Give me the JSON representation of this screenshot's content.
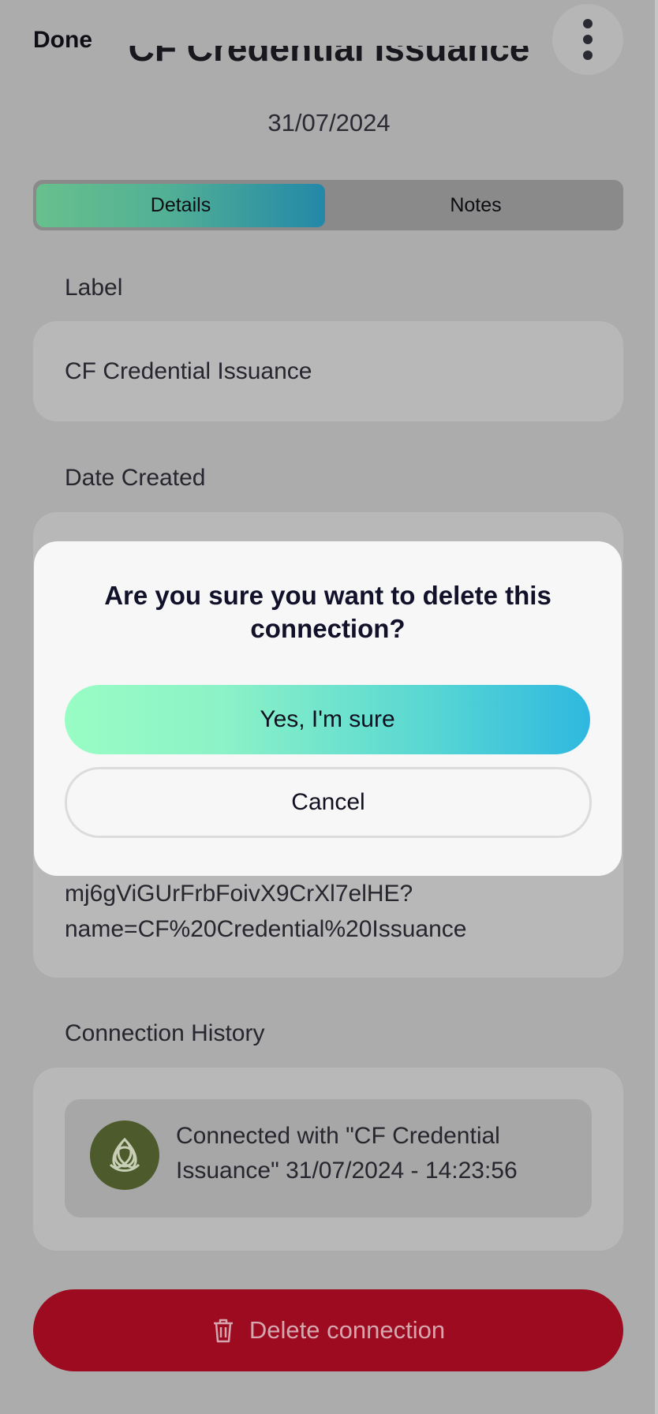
{
  "header": {
    "done_label": "Done",
    "title": "CF Credential Issuance",
    "date": "31/07/2024"
  },
  "tabs": [
    {
      "label": "Details",
      "active": true
    },
    {
      "label": "Notes",
      "active": false
    }
  ],
  "details": {
    "label_title": "Label",
    "label_value": "CF Credential Issuance",
    "date_created_title": "Date Created",
    "url_lines": [
      "mj6gViGUrFrbFoivX9CrXl7elHE?",
      "name=CF%20Credential%20Issuance"
    ]
  },
  "history": {
    "title": "Connection History",
    "entry_bold": "Connected with \"CF Credential Issuance\"",
    "entry_time": "31/07/2024 - 14:23:56",
    "avatar_icon": "celtic-knot-icon"
  },
  "delete_button": {
    "label": "Delete connection",
    "icon": "trash-icon"
  },
  "modal": {
    "title": "Are you sure you want to delete this connection?",
    "confirm_label": "Yes, I'm sure",
    "cancel_label": "Cancel"
  },
  "colors": {
    "delete_red": "#9c0b20",
    "confirm_gradient_start": "#98fdc4",
    "confirm_gradient_end": "#2fb8e0",
    "tab_gradient_start": "#68c08d",
    "tab_gradient_end": "#2388a8",
    "avatar_bg": "#4d5b2c"
  }
}
